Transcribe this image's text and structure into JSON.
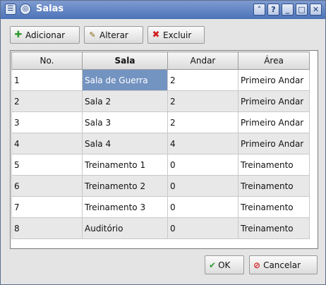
{
  "window": {
    "title": "Salas"
  },
  "toolbar": {
    "add_label": "Adicionar",
    "edit_label": "Alterar",
    "delete_label": "Excluir"
  },
  "table": {
    "headers": [
      "No.",
      "Sala",
      "Andar",
      "Área"
    ],
    "rows": [
      [
        "1",
        "Sala de Guerra",
        "2",
        "Primeiro Andar"
      ],
      [
        "2",
        "Sala 2",
        "2",
        "Primeiro Andar"
      ],
      [
        "3",
        "Sala 3",
        "2",
        "Primeiro Andar"
      ],
      [
        "4",
        "Sala 4",
        "4",
        "Primeiro Andar"
      ],
      [
        "5",
        "Treinamento 1",
        "0",
        "Treinamento"
      ],
      [
        "6",
        "Treinamento 2",
        "0",
        "Treinamento"
      ],
      [
        "7",
        "Treinamento 3",
        "0",
        "Treinamento"
      ],
      [
        "8",
        "Auditório",
        "0",
        "Treinamento"
      ]
    ],
    "selected_row": 0,
    "selected_col": 1
  },
  "dialog": {
    "ok_label": "OK",
    "cancel_label": "Cancelar"
  },
  "colors": {
    "titlebar": "#4c73b8",
    "selection": "#7393c1",
    "alt_row": "#e8e8e8"
  }
}
